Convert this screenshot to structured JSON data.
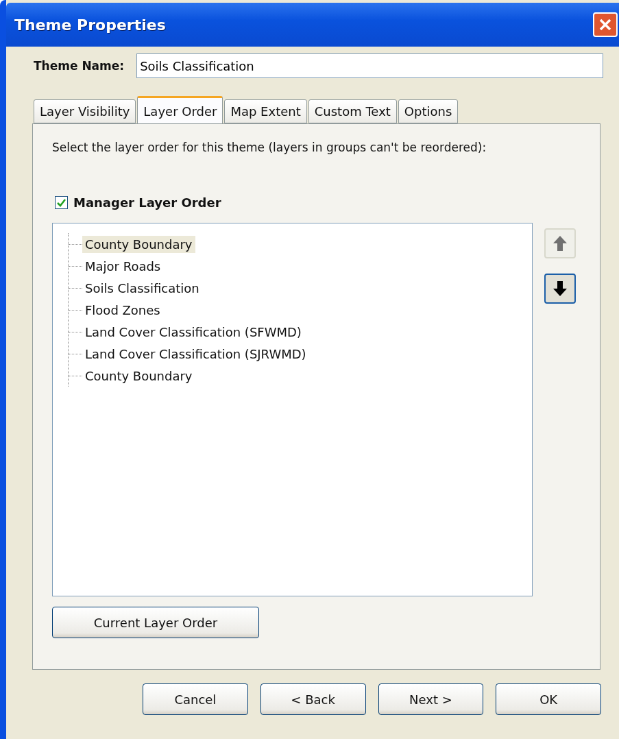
{
  "window": {
    "title": "Theme Properties"
  },
  "theme_name": {
    "label": "Theme Name:",
    "value": "Soils Classification"
  },
  "tabs": [
    {
      "label": "Layer Visibility",
      "selected": false
    },
    {
      "label": "Layer Order",
      "selected": true
    },
    {
      "label": "Map Extent",
      "selected": false
    },
    {
      "label": "Custom Text",
      "selected": false
    },
    {
      "label": "Options",
      "selected": false
    }
  ],
  "instruction": "Select the layer order for this theme (layers in groups can't be reordered):",
  "manager_layer_order": {
    "label": "Manager Layer Order",
    "checked": true
  },
  "layers": [
    {
      "label": "County Boundary",
      "selected": true
    },
    {
      "label": "Major Roads",
      "selected": false
    },
    {
      "label": "Soils Classification",
      "selected": false
    },
    {
      "label": "Flood Zones",
      "selected": false
    },
    {
      "label": "Land Cover Classification (SFWMD)",
      "selected": false
    },
    {
      "label": "Land Cover Classification (SJRWMD)",
      "selected": false
    },
    {
      "label": "County Boundary",
      "selected": false
    }
  ],
  "move_buttons": [
    {
      "kind": "up",
      "disabled": true
    },
    {
      "kind": "down",
      "disabled": false
    }
  ],
  "current_layer_order_button": "Current Layer Order",
  "buttons": [
    "Cancel",
    "< Back",
    "Next >",
    "OK"
  ]
}
